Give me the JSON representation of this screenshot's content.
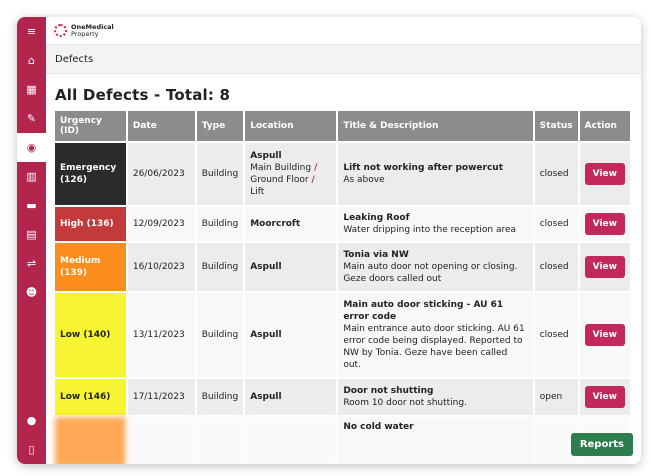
{
  "app": {
    "logo_line1": "OneMedical",
    "logo_line2": "Property"
  },
  "sidebar": {
    "items": [
      {
        "icon": "menu-icon",
        "glyph": "≡"
      },
      {
        "icon": "home-icon",
        "glyph": "⌂"
      },
      {
        "icon": "building-icon",
        "glyph": "▦"
      },
      {
        "icon": "pencil-icon",
        "glyph": "✎"
      },
      {
        "icon": "eye-icon",
        "glyph": "◉",
        "active": true
      },
      {
        "icon": "buildings-icon",
        "glyph": "▥"
      },
      {
        "icon": "note-icon",
        "glyph": "▬"
      },
      {
        "icon": "document-icon",
        "glyph": "▤"
      },
      {
        "icon": "handshake-icon",
        "glyph": "⇌"
      },
      {
        "icon": "users-icon",
        "glyph": "☻"
      }
    ],
    "bottom": [
      {
        "icon": "user-icon",
        "glyph": "●"
      },
      {
        "icon": "door-icon",
        "glyph": "▯"
      }
    ]
  },
  "breadcrumb": "Defects",
  "page": {
    "title": "All Defects - Total: 8"
  },
  "table": {
    "headers": [
      "Urgency (ID)",
      "Date",
      "Type",
      "Location",
      "Title & Description",
      "Status",
      "Action"
    ],
    "rows": [
      {
        "urgency": "Emergency (126)",
        "date": "26/06/2023",
        "type": "Building",
        "loc_main": "Aspull",
        "loc_sub": [
          "Main Building",
          "Ground Floor",
          "Lift"
        ],
        "title": "Lift not working after powercut",
        "desc": "As above",
        "status": "closed",
        "action": "View"
      },
      {
        "urgency": "High (136)",
        "date": "12/09/2023",
        "type": "Building",
        "loc_main": "Moorcroft",
        "title": "Leaking Roof",
        "desc": "Water dripping into the reception area",
        "status": "closed",
        "action": "View"
      },
      {
        "urgency": "Medium (139)",
        "date": "16/10/2023",
        "type": "Building",
        "loc_main": "Aspull",
        "title": "Tonia via NW",
        "desc": "Main auto door not opening or closing. Geze doors called out",
        "status": "closed",
        "action": "View"
      },
      {
        "urgency": "Low (140)",
        "date": "13/11/2023",
        "type": "Building",
        "loc_main": "Aspull",
        "title": "Main auto door sticking - AU 61 error code",
        "desc": "Main entrance auto door sticking. AU 61 error code being displayed. Reported to NW by Tonia. Geze have been called out.",
        "status": "closed",
        "action": "View"
      },
      {
        "urgency": "Low (146)",
        "date": "17/11/2023",
        "type": "Building",
        "loc_main": "Aspull",
        "title": "Door not shutting",
        "desc": "Room 10 door not shutting.",
        "status": "open",
        "action": "View"
      },
      {
        "title": "No cold water"
      }
    ]
  },
  "footer": {
    "reports_label": "Reports"
  },
  "colors": {
    "brand": "#b2264d",
    "emergency": "#2b2b2b",
    "high": "#c33a3a",
    "medium": "#fb8c1e",
    "low": "#f7f532",
    "view_button": "#c2295a",
    "reports_button": "#2e7d4f"
  }
}
